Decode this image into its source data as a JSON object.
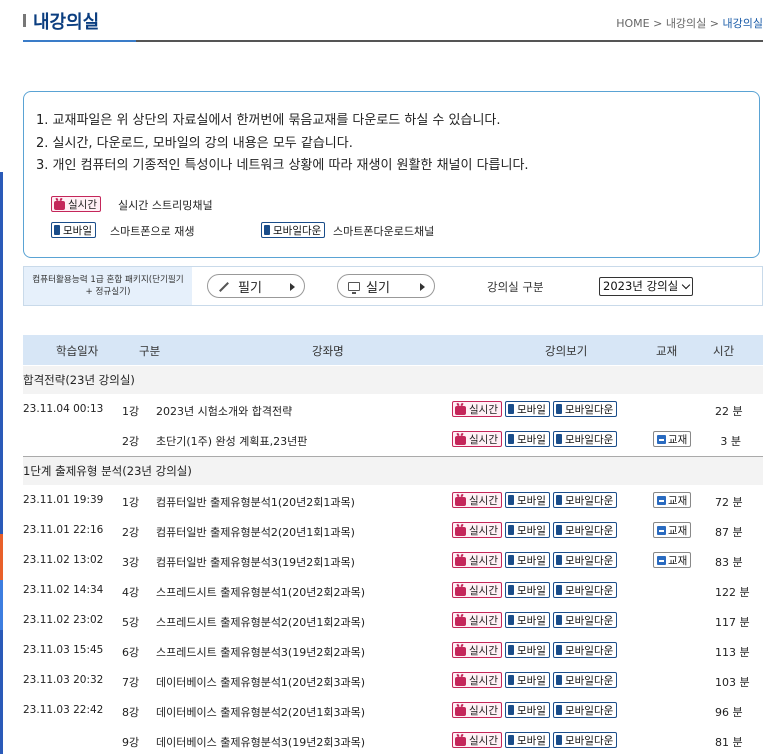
{
  "header": {
    "title": "내강의실",
    "breadcrumb": {
      "home": "HOME",
      "sep1": ">",
      "level1": "내강의실",
      "sep2": ">",
      "current": "내강의실"
    }
  },
  "notice": {
    "lines": [
      "1. 교재파일은 위 상단의 자료실에서 한꺼번에 묶음교재를 다운로드 하실 수 있습니다.",
      "2. 실시간, 다운로드, 모바일의 강의 내용은 모두 같습니다.",
      "3. 개인 컴퓨터의 기종적인 특성이나 네트워크 상황에 따라 재생이 원활한 채널이 다릅니다."
    ],
    "legend": {
      "live_label": "실시간",
      "live_desc": "실시간 스트리밍채널",
      "mobile_label": "모바일",
      "mobile_desc": "스마트폰으로 재생",
      "mdl_label": "모바일다운",
      "mdl_desc": "스마트폰다운로드채널"
    }
  },
  "filter": {
    "package_line1": "컴퓨터활용능력 1급 혼합 패키지(단기필기",
    "package_line2": "+ 정규실기)",
    "written_label": "필기",
    "practical_label": "실기",
    "room_label": "강의실 구분",
    "room_select": "2023년 강의실"
  },
  "table": {
    "headers": {
      "date": "학습일자",
      "type": "구분",
      "name": "강좌명",
      "view": "강의보기",
      "book": "교재",
      "time": "시간"
    },
    "btn": {
      "live": "실시간",
      "mobile": "모바일",
      "mdl": "모바일다운",
      "book": "교재",
      "unit": "분"
    },
    "sections": [
      {
        "title": "합격전략(23년 강의실)",
        "rows": [
          {
            "date": "23.11.04 00:13",
            "no": "1강",
            "name": "2023년 시험소개와 합격전략",
            "book": false,
            "time": "22"
          },
          {
            "date": "",
            "no": "2강",
            "name": "초단기(1주) 완성 계획표,23년판",
            "book": true,
            "time": "3"
          }
        ]
      },
      {
        "title": "1단계 출제유형 분석(23년 강의실)",
        "rows": [
          {
            "date": "23.11.01 19:39",
            "no": "1강",
            "name": "컴퓨터일반 출제유형분석1(20년2회1과목)",
            "book": true,
            "time": "72"
          },
          {
            "date": "23.11.01 22:16",
            "no": "2강",
            "name": "컴퓨터일반 출제유형분석2(20년1회1과목)",
            "book": true,
            "time": "87"
          },
          {
            "date": "23.11.02 13:02",
            "no": "3강",
            "name": "컴퓨터일반 출제유형분석3(19년2회1과목)",
            "book": true,
            "time": "83"
          },
          {
            "date": "23.11.02 14:34",
            "no": "4강",
            "name": "스프레드시트 출제유형분석1(20년2회2과목)",
            "book": false,
            "time": "122"
          },
          {
            "date": "23.11.02 23:02",
            "no": "5강",
            "name": "스프레드시트 출제유형분석2(20년1회2과목)",
            "book": false,
            "time": "117"
          },
          {
            "date": "23.11.03 15:45",
            "no": "6강",
            "name": "스프레드시트 출제유형분석3(19년2회2과목)",
            "book": false,
            "time": "113"
          },
          {
            "date": "23.11.03 20:32",
            "no": "7강",
            "name": "데이터베이스 출제유형분석1(20년2회3과목)",
            "book": false,
            "time": "103"
          },
          {
            "date": "23.11.03 22:42",
            "no": "8강",
            "name": "데이터베이스 출제유형분석2(20년1회3과목)",
            "book": false,
            "time": "96"
          },
          {
            "date": "",
            "no": "9강",
            "name": "데이터베이스 출제유형분석3(19년2회3과목)",
            "book": false,
            "time": "81"
          }
        ]
      }
    ]
  }
}
